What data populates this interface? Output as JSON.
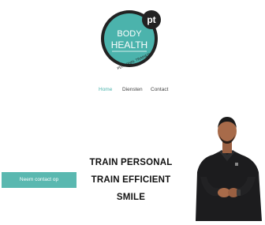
{
  "logo": {
    "line1": "BODY",
    "line2": "HEALTH",
    "badge": "pt",
    "tagline": "PERSONAL TRAINER",
    "colors": {
      "ring": "#222222",
      "fill": "#4bb3ac",
      "text": "#ffffff"
    }
  },
  "nav": {
    "items": [
      {
        "label": "Home",
        "active": true
      },
      {
        "label": "Diensten",
        "active": false
      },
      {
        "label": "Contact",
        "active": false
      }
    ]
  },
  "hero": {
    "lines": [
      "TRAIN PERSONAL",
      "TRAIN EFFICIENT",
      "SMILE"
    ]
  },
  "cta": {
    "label": "Neem contact op"
  },
  "colors": {
    "accent": "#4bb3ac",
    "button": "#5ab8b0",
    "text": "#111111"
  }
}
